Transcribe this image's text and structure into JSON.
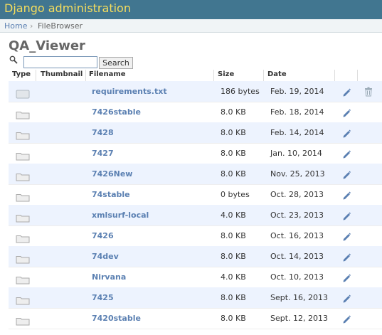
{
  "header": {
    "site_title": "Django administration"
  },
  "breadcrumbs": {
    "home": "Home",
    "separator": "›",
    "current": "FileBrowser"
  },
  "page": {
    "title": "QA_Viewer"
  },
  "search": {
    "value": "",
    "placeholder": "",
    "button_label": "Search"
  },
  "table": {
    "columns": [
      "Type",
      "Thumbnail",
      "Filename",
      "Size",
      "Date"
    ],
    "rows": [
      {
        "type": "file-icon",
        "filename": "requirements.txt",
        "size": "186 bytes",
        "date": "Feb. 19, 2014",
        "deletable": true
      },
      {
        "type": "folder-icon",
        "filename": "7426stable",
        "size": "8.0 KB",
        "date": "Feb. 18, 2014"
      },
      {
        "type": "folder-icon",
        "filename": "7428",
        "size": "8.0 KB",
        "date": "Feb. 14, 2014"
      },
      {
        "type": "folder-icon",
        "filename": "7427",
        "size": "8.0 KB",
        "date": "Jan. 10, 2014"
      },
      {
        "type": "folder-icon",
        "filename": "7426New",
        "size": "8.0 KB",
        "date": "Nov. 25, 2013"
      },
      {
        "type": "folder-icon",
        "filename": "74stable",
        "size": "0 bytes",
        "date": "Oct. 28, 2013"
      },
      {
        "type": "folder-icon",
        "filename": "xmlsurf-local",
        "size": "4.0 KB",
        "date": "Oct. 23, 2013"
      },
      {
        "type": "folder-icon",
        "filename": "7426",
        "size": "8.0 KB",
        "date": "Oct. 16, 2013"
      },
      {
        "type": "folder-icon",
        "filename": "74dev",
        "size": "8.0 KB",
        "date": "Oct. 14, 2013"
      },
      {
        "type": "folder-icon",
        "filename": "Nirvana",
        "size": "4.0 KB",
        "date": "Oct. 10, 2013"
      },
      {
        "type": "folder-icon",
        "filename": "7425",
        "size": "8.0 KB",
        "date": "Sept. 16, 2013"
      },
      {
        "type": "folder-icon",
        "filename": "7420stable",
        "size": "8.0 KB",
        "date": "Sept. 12, 2013"
      }
    ]
  },
  "colors": {
    "header_bg": "#417690",
    "header_text": "#f5dd5d",
    "link": "#5b80b2",
    "alt_row": "#edf3fe",
    "edit_icon": "#5b80b2",
    "delete_icon": "#9aaab6"
  }
}
